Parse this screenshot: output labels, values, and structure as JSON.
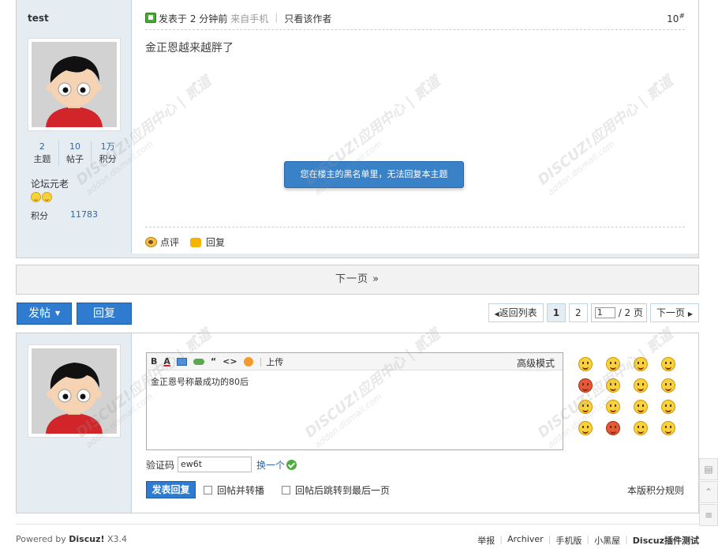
{
  "post": {
    "author": "test",
    "stats": [
      {
        "value": "2",
        "label": "主题"
      },
      {
        "value": "10",
        "label": "帖子"
      },
      {
        "value": "1万",
        "label": "积分"
      }
    ],
    "rank": "论坛元老",
    "credit_label": "积分",
    "credit_value": "11783",
    "time": "发表于 2 分钟前",
    "from_mobile": "来自手机",
    "sep": "|",
    "only_author": "只看该作者",
    "floor": "10",
    "floor_mark": "#",
    "content": "金正恩越来越胖了",
    "notice": "您在楼主的黑名单里，无法回复本主题",
    "comment_label": "点评",
    "reply_label": "回复"
  },
  "next_page": "下一页 »",
  "actions": {
    "post_label": "发帖",
    "reply_label": "回复"
  },
  "pager": {
    "back": "返回列表",
    "page1": "1",
    "page2": "2",
    "input_value": "1",
    "total": "/ 2 页",
    "next": "下一页"
  },
  "editor": {
    "toolbar_bold": "B",
    "toolbar_color": "A",
    "toolbar_quote": "“",
    "toolbar_code": "<>",
    "toolbar_sep": "|",
    "toolbar_upload": "上传",
    "advanced": "高级模式",
    "content": "金正恩号称最成功的80后"
  },
  "captcha": {
    "label": "验证码",
    "value": "ew6t",
    "change": "换一个"
  },
  "submit": {
    "button": "发表回复",
    "option1": "回帖并转播",
    "option2": "回帖后跳转到最后一页",
    "rules": "本版积分规则"
  },
  "footer": {
    "powered_prefix": "Powered by",
    "powered_brand": "Discuz!",
    "version": "X3.4",
    "links": [
      "举报",
      "Archiver",
      "手机版",
      "小黑屋",
      "Discuz插件测试"
    ]
  },
  "watermark": {
    "brand": "DISCUZ!应用中心 | 贰道",
    "domain": "addon.dismall.com"
  },
  "colors": {
    "accent_blue": "#2e7bcf",
    "side_bg": "#e5edf2",
    "link": "#336699"
  }
}
